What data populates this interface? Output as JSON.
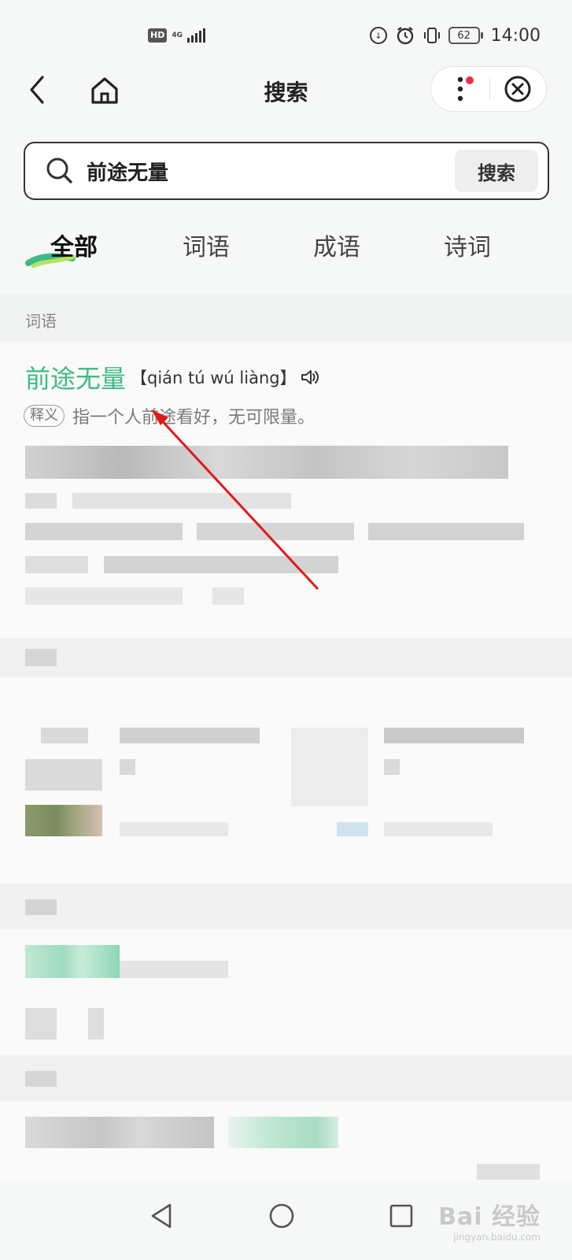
{
  "status_bar": {
    "hd": "HD",
    "network": "4G",
    "battery": "62",
    "time": "14:00"
  },
  "nav": {
    "title": "搜索",
    "back_icon": "chevron-left-icon",
    "home_icon": "home-icon",
    "more_icon": "more-vertical-icon",
    "close_icon": "close-circle-icon"
  },
  "search": {
    "value": "前途无量",
    "button_label": "搜索"
  },
  "tabs": [
    {
      "label": "全部",
      "active": true
    },
    {
      "label": "词语",
      "active": false
    },
    {
      "label": "成语",
      "active": false
    },
    {
      "label": "诗词",
      "active": false
    }
  ],
  "result": {
    "section_label": "词语",
    "word": "前途无量",
    "pinyin": "【qián tú wú liàng】",
    "definition_badge": "释义",
    "definition": "指一个人前途看好，无可限量。"
  },
  "colors": {
    "accent_green": "#3fba86",
    "annotation_red": "#e01a1a"
  },
  "watermark": {
    "main": "Bai 经验",
    "sub": "jingyan.baidu.com"
  }
}
